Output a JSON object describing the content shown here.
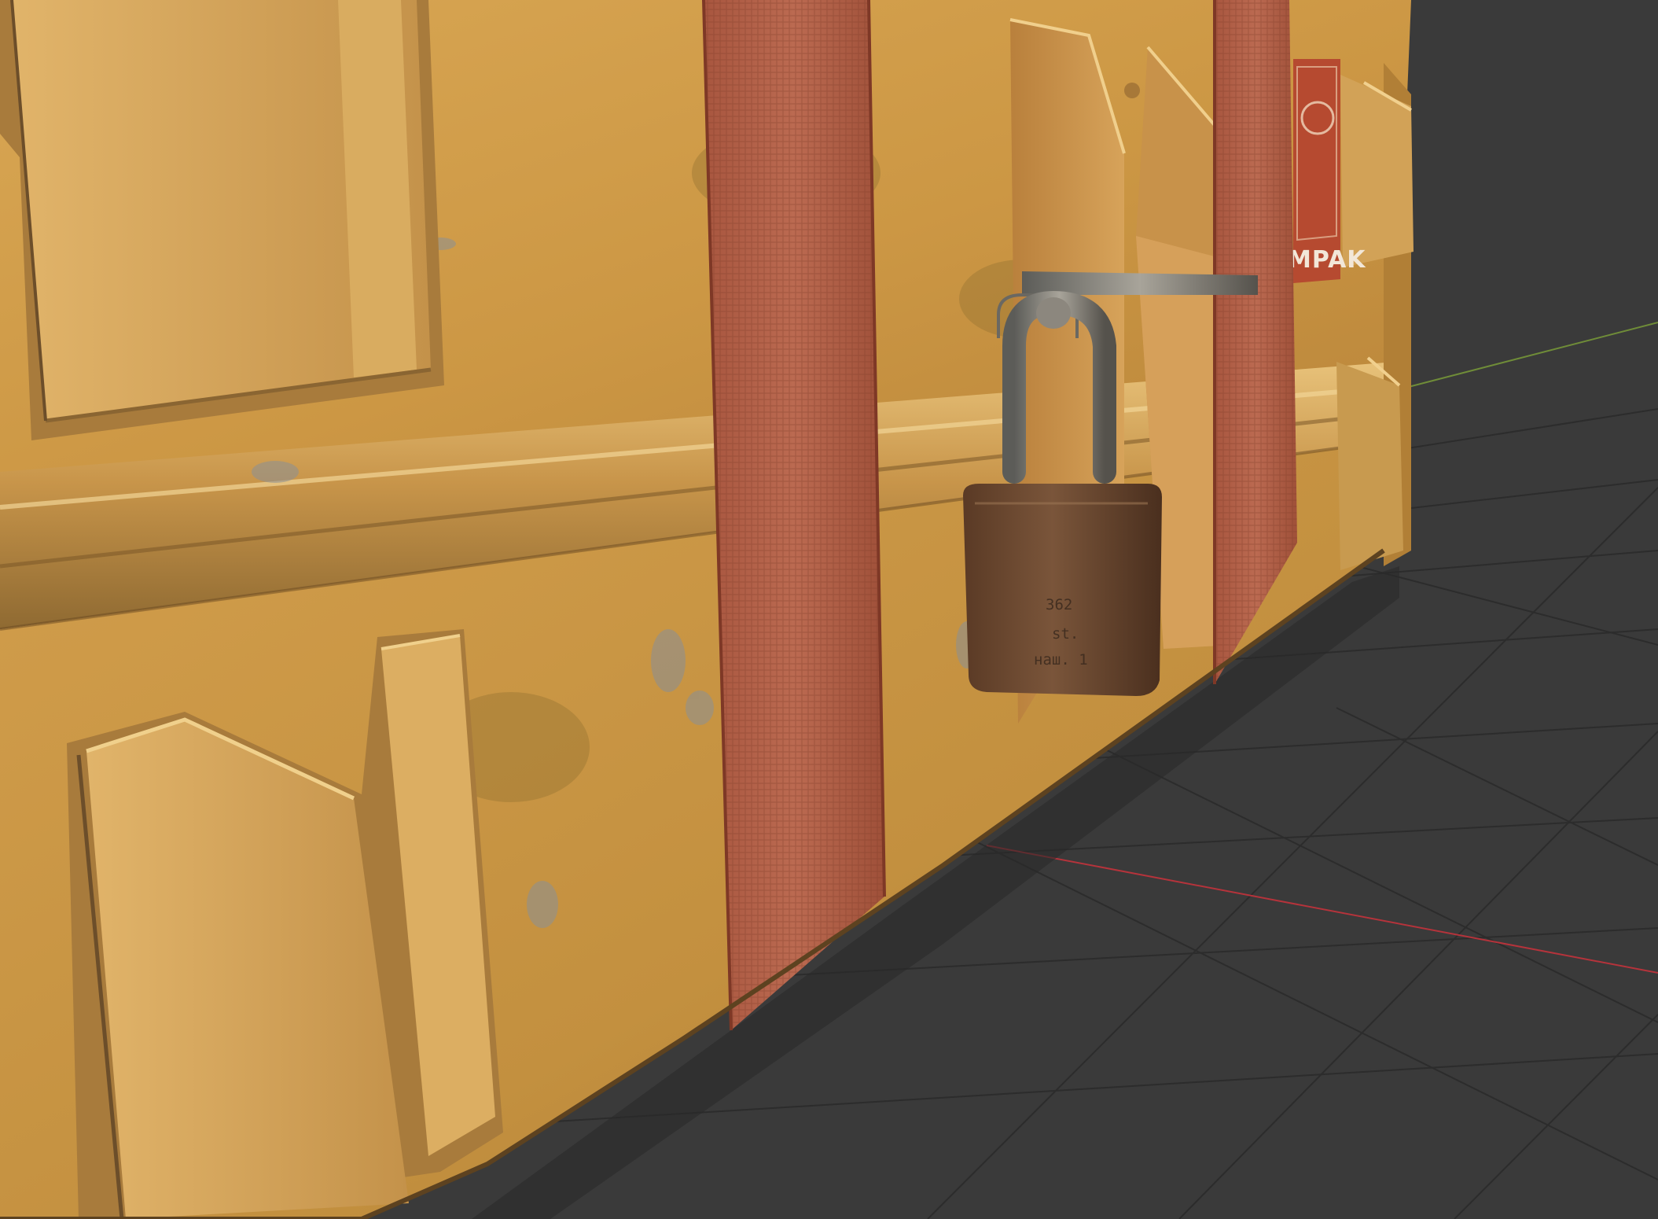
{
  "viewport": {
    "label": "3D viewport",
    "background_color": "#3a3a3a",
    "grid_color": "#2d2d2d",
    "x_axis_color": "#b5333b",
    "y_axis_color": "#7a9a3a"
  },
  "object": {
    "type": "yellow metal transport case",
    "body_color": "#cf9c4a",
    "strap_color": "#b8614a",
    "sticker": {
      "text": "MPAK",
      "color": "#b64a30"
    },
    "padlock": {
      "color": "#6d4a30",
      "stamp_lines": [
        "362",
        "st.",
        "наш. 1"
      ]
    }
  },
  "icons": [
    "padlock-icon"
  ]
}
